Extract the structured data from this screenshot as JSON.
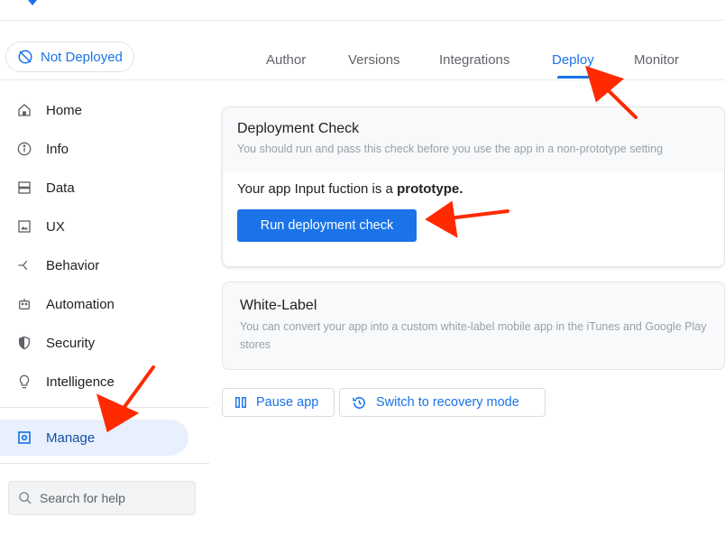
{
  "status": {
    "label": "Not Deployed",
    "icon": "not-deployed-icon"
  },
  "tabs": [
    {
      "label": "Author"
    },
    {
      "label": "Versions"
    },
    {
      "label": "Integrations"
    },
    {
      "label": "Deploy",
      "active": true
    },
    {
      "label": "Monitor"
    }
  ],
  "sidebar": {
    "items": [
      {
        "label": "Home",
        "icon": "home-icon"
      },
      {
        "label": "Info",
        "icon": "info-icon"
      },
      {
        "label": "Data",
        "icon": "data-icon"
      },
      {
        "label": "UX",
        "icon": "ux-icon"
      },
      {
        "label": "Behavior",
        "icon": "behavior-icon"
      },
      {
        "label": "Automation",
        "icon": "automation-icon"
      },
      {
        "label": "Security",
        "icon": "security-icon"
      },
      {
        "label": "Intelligence",
        "icon": "lightbulb-icon"
      }
    ],
    "manage": {
      "label": "Manage",
      "icon": "manage-icon",
      "selected": true
    },
    "search_placeholder": "Search for help"
  },
  "deployment_check": {
    "title": "Deployment Check",
    "subtitle": "You should run and pass this check before you use the app in a non-prototype setting",
    "message_prefix": "Your app Input fuction is a ",
    "message_bold": "prototype.",
    "button": "Run deployment check"
  },
  "white_label": {
    "title": "White-Label",
    "description": "You can convert your app into a custom white-label mobile app in the iTunes and Google Play stores"
  },
  "actions": {
    "pause": "Pause app",
    "recovery": "Switch to recovery mode"
  },
  "colors": {
    "accent": "#1a73e8",
    "annotation": "#ff2a00",
    "selected_bg": "#e8f0fe"
  }
}
